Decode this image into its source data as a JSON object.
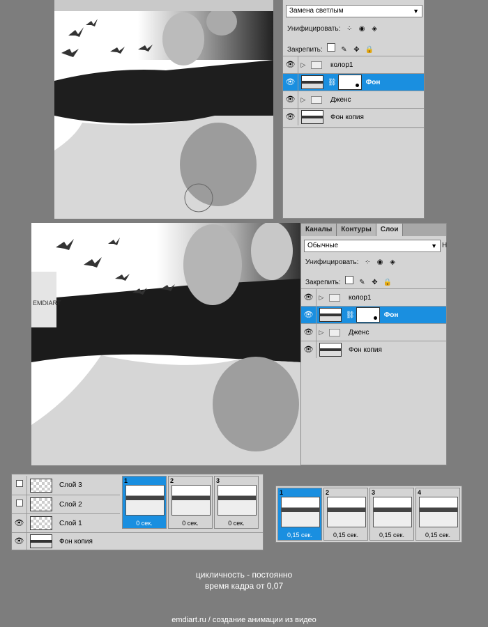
{
  "top_panel": {
    "blend_mode": "Замена светлым",
    "unify_label": "Унифицировать:",
    "lock_label": "Закрепить:",
    "layers": [
      {
        "name": "колор1",
        "type": "group",
        "selected": false
      },
      {
        "name": "Фон",
        "type": "masked",
        "selected": true
      },
      {
        "name": "Дженс",
        "type": "group",
        "selected": false
      },
      {
        "name": "Фон  копия",
        "type": "image",
        "selected": false
      }
    ]
  },
  "main_panel": {
    "tabs": [
      "Каналы",
      "Контуры",
      "Слои"
    ],
    "active_tab": "Слои",
    "blend_mode": "Обычные",
    "side_letter": "Н",
    "unify_label": "Унифицировать:",
    "lock_label": "Закрепить:",
    "layers": [
      {
        "name": "колор1",
        "type": "group",
        "selected": false
      },
      {
        "name": "Фон",
        "type": "masked",
        "selected": true
      },
      {
        "name": "Дженс",
        "type": "group",
        "selected": false
      },
      {
        "name": "Фон  копия",
        "type": "image",
        "selected": false
      }
    ]
  },
  "watermark_text": "EMDIART",
  "anim_layers": [
    {
      "name": "Слой 3",
      "visible": false
    },
    {
      "name": "Слой 2",
      "visible": false
    },
    {
      "name": "Слой 1",
      "visible": true
    },
    {
      "name": "Фон  копия",
      "visible": true
    }
  ],
  "timeline_left": [
    {
      "num": "1",
      "delay": "0 сек.",
      "selected": true
    },
    {
      "num": "2",
      "delay": "0 сек.",
      "selected": false
    },
    {
      "num": "3",
      "delay": "0 сек.",
      "selected": false
    }
  ],
  "timeline_right": [
    {
      "num": "1",
      "delay": "0,15 сек.",
      "selected": true
    },
    {
      "num": "2",
      "delay": "0,15 сек.",
      "selected": false
    },
    {
      "num": "3",
      "delay": "0,15 сек.",
      "selected": false
    },
    {
      "num": "4",
      "delay": "0,15 сек.",
      "selected": false
    }
  ],
  "caption": {
    "line1": "цикличность - постоянно",
    "line2": "время кадра от 0,07",
    "footer": "emdiart.ru / создание анимации из видео"
  },
  "colors": {
    "selection": "#1a8fe0",
    "background": "#7d7d7d",
    "panel": "#d4d4d4"
  }
}
